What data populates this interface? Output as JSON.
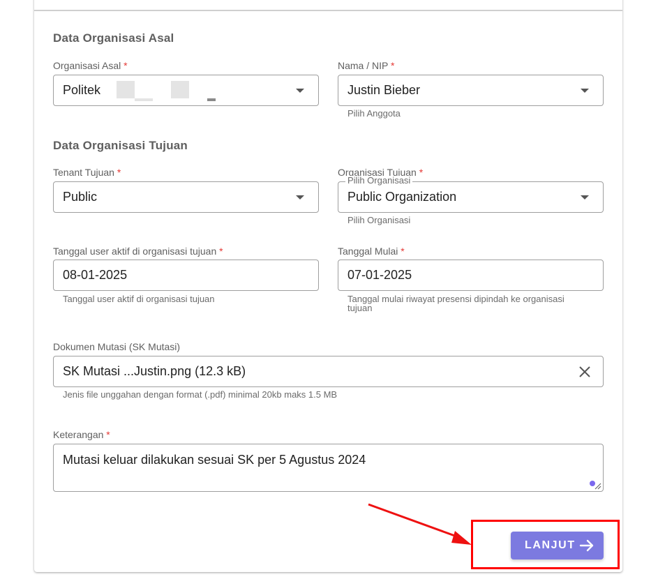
{
  "sections": {
    "origin_title": "Data Organisasi Asal",
    "destination_title": "Data Organisasi Tujuan"
  },
  "required_marker": "*",
  "fields": {
    "organisasi_asal": {
      "label": "Organisasi Asal",
      "value": "Politek"
    },
    "nama_nip": {
      "label": "Nama / NIP",
      "value": "Justin Bieber",
      "hint": "Pilih Anggota"
    },
    "tenant_tujuan": {
      "label": "Tenant Tujuan",
      "value": "Public"
    },
    "organisasi_tujuan": {
      "label": "Organisasi Tujuan",
      "floating_label": "Pilih Organisasi",
      "value": "Public Organization",
      "hint": "Pilih Organisasi"
    },
    "tanggal_aktif": {
      "label": "Tanggal user aktif di organisasi tujuan",
      "value": "08-01-2025",
      "hint": "Tanggal user aktif di organisasi tujuan"
    },
    "tanggal_mulai": {
      "label": "Tanggal Mulai",
      "value": "07-01-2025",
      "hint_line1": "Tanggal mulai riwayat presensi dipindah ke organisasi",
      "hint_line2": "tujuan"
    },
    "dokumen_mutasi": {
      "label": "Dokumen Mutasi (SK Mutasi)",
      "value": "SK Mutasi ...Justin.png (12.3 kB)",
      "hint": "Jenis file unggahan dengan format (.pdf) minimal 20kb maks 1.5 MB"
    },
    "keterangan": {
      "label": "Keterangan",
      "value": "Mutasi keluar dilakukan sesuai SK per 5 Agustus 2024"
    }
  },
  "actions": {
    "next_label": "LANJUT"
  },
  "colors": {
    "accent": "#7c7ae0",
    "required": "#e53935",
    "highlight": "#ff0000"
  },
  "icons": {
    "dropdown": "chevron-down-icon",
    "clear": "close-icon",
    "next": "arrow-right-icon"
  }
}
